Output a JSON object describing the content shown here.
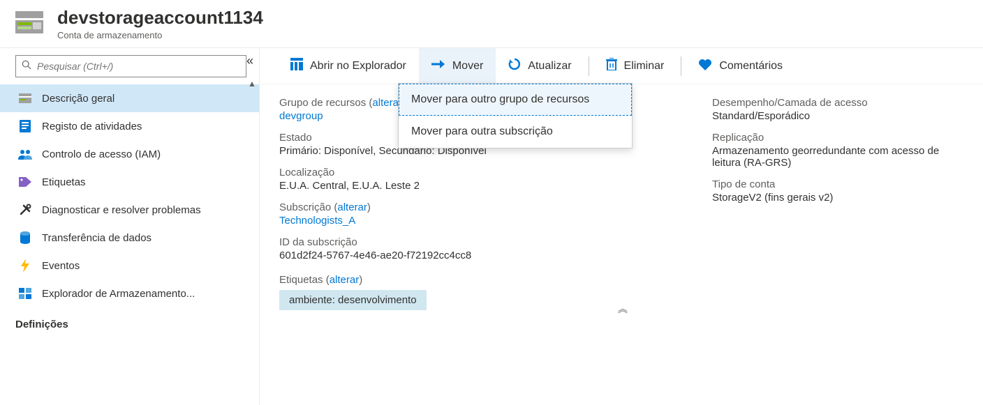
{
  "header": {
    "title": "devstorageaccount1134",
    "subtitle": "Conta de armazenamento"
  },
  "sidebar": {
    "search_placeholder": "Pesquisar (Ctrl+/)",
    "items": [
      {
        "label": "Descrição geral"
      },
      {
        "label": "Registo de atividades"
      },
      {
        "label": "Controlo de acesso (IAM)"
      },
      {
        "label": "Etiquetas"
      },
      {
        "label": "Diagnosticar e resolver problemas"
      },
      {
        "label": "Transferência de dados"
      },
      {
        "label": "Eventos"
      },
      {
        "label": "Explorador de Armazenamento..."
      }
    ],
    "section_label": "Definições"
  },
  "toolbar": {
    "open_explorer": "Abrir no Explorador",
    "move": "Mover",
    "refresh": "Atualizar",
    "delete": "Eliminar",
    "feedback": "Comentários"
  },
  "dropdown": {
    "move_rg": "Mover para outro grupo de recursos",
    "move_sub": "Mover para outra subscrição"
  },
  "left_col": {
    "rg_label_prefix": "Grupo de recursos (",
    "rg_change": "alterar",
    "rg_label_suffix": ")",
    "rg_value": "devgroup",
    "state_label": "Estado",
    "state_value": "Primário: Disponível, Secundário: Disponível",
    "loc_label": "Localização",
    "loc_value": "E.U.A. Central, E.U.A. Leste 2",
    "sub_label_prefix": "Subscrição (",
    "sub_change": "alterar",
    "sub_label_suffix": ")",
    "sub_value": "Technologists_A",
    "subid_label": "ID da subscrição",
    "subid_value": "601d2f24-5767-4e46-ae20-f72192cc4cc8",
    "tags_label_prefix": "Etiquetas (",
    "tags_change": "alterar",
    "tags_label_suffix": ")",
    "tag_chip": "ambiente: desenvolvimento"
  },
  "right_col": {
    "perf_label": "Desempenho/Camada de acesso",
    "perf_value": "Standard/Esporádico",
    "repl_label": "Replicação",
    "repl_value": "Armazenamento georredundante com acesso de leitura (RA-GRS)",
    "type_label": "Tipo de conta",
    "type_value": "StorageV2 (fins gerais v2)"
  }
}
